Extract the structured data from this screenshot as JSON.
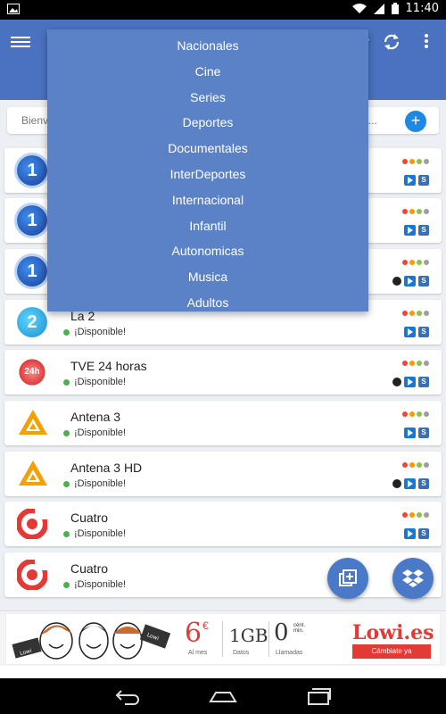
{
  "status_bar": {
    "time": "11:40",
    "icons": [
      "image-icon",
      "wifi-icon",
      "signal-icon",
      "battery-icon"
    ]
  },
  "app_bar": {
    "color": "#4a72c0",
    "icons": [
      "menu-icon",
      "chevron-down-icon",
      "refresh-icon",
      "overflow-menu-icon"
    ]
  },
  "search": {
    "placeholder_start": "Bienv",
    "placeholder_end": "os..."
  },
  "dropdown": {
    "items": [
      "Nacionales",
      "Cine",
      "Series",
      "Deportes",
      "Documentales",
      "InterDeportes",
      "Internacional",
      "Infantil",
      "Autonomicas",
      "Musica",
      "Adultos"
    ]
  },
  "channels": [
    {
      "name": "",
      "status": "",
      "logo": "tve-1",
      "logo_text": "1"
    },
    {
      "name": "",
      "status": "",
      "logo": "tve-1",
      "logo_text": "1"
    },
    {
      "name": "",
      "status": "",
      "logo": "tve-1",
      "logo_text": "1"
    },
    {
      "name": "La 2",
      "status": "¡Disponible!",
      "logo": "la2",
      "logo_text": "2"
    },
    {
      "name": "TVE 24 horas",
      "status": "¡Disponible!",
      "logo": "24h",
      "logo_text": "24h"
    },
    {
      "name": "Antena 3",
      "status": "¡Disponible!",
      "logo": "antena3",
      "logo_text": ""
    },
    {
      "name": "Antena 3 HD",
      "status": "¡Disponible!",
      "logo": "antena3",
      "logo_text": ""
    },
    {
      "name": "Cuatro",
      "status": "¡Disponible!",
      "logo": "cuatro",
      "logo_text": ""
    },
    {
      "name": "Cuatro",
      "status": "¡Disponible!",
      "logo": "cuatro",
      "logo_text": ""
    }
  ],
  "badges": {
    "stream_label": "S"
  },
  "colors": {
    "available": "#4caf50",
    "quality_dots": [
      "#f44336",
      "#ff9800",
      "#8bc34a",
      "#9e9e9e"
    ],
    "fab": "#4a79c7"
  },
  "ad": {
    "price": "6",
    "currency": "€",
    "price_caption": "Al mes",
    "data": "1GB",
    "data_caption": "Datos",
    "calls": "0",
    "calls_unit": "cént. min.",
    "calls_caption": "Llamadas",
    "brand": "Lowi.es",
    "cta": "Cámbiate ya",
    "sign_left": "Lowi",
    "sign_right": "Lowi"
  },
  "nav": {
    "icons": [
      "back-icon",
      "home-icon",
      "recents-icon"
    ]
  }
}
